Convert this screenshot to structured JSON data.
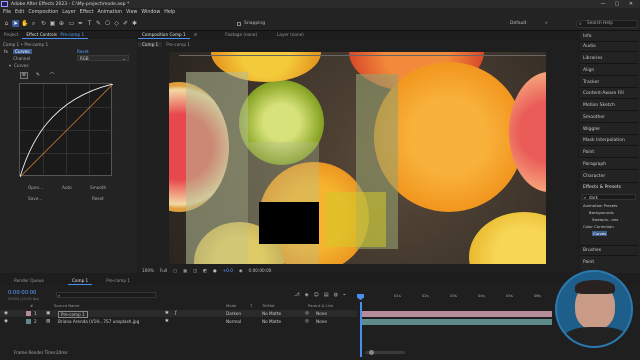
{
  "titlebar": {
    "title": "Adobe After Effects 2023 - C:\\My-project\\mode.aep *",
    "buttons": [
      "—",
      "▢",
      "✕"
    ]
  },
  "menu": [
    "File",
    "Edit",
    "Composition",
    "Layer",
    "Effect",
    "Animation",
    "View",
    "Window",
    "Help"
  ],
  "toolbar": {
    "snapping": "Snapping",
    "workspace_default": "Default",
    "workspace_menu": "»",
    "search_placeholder": "Search Help"
  },
  "project_panel": {
    "tab_project": "Project",
    "tab_effect_controls": "Effect Controls",
    "tab_layer": "Pre-comp 1",
    "path": "Comp 1 • Pre-comp 1"
  },
  "effect_controls": {
    "effect_name": "Curves",
    "fx_label": "fx",
    "reset_label": "Reset",
    "channel_label": "Channel",
    "channel_value": "RGB",
    "curves_label": "Curves",
    "buttons": [
      "Open...",
      "Auto",
      "Smooth",
      "Save...",
      "Reset"
    ]
  },
  "composition": {
    "tab_title": "Composition Comp 1",
    "menu_icon": "≡",
    "footage_tab": "Footage (none)",
    "layer_tab": "Layer (none)",
    "subtab_comp": "Comp 1",
    "subtab_precomp": "Pre-comp 1",
    "zoom": "100%",
    "resolution": "Full",
    "exposure": "+0.0",
    "timecode": "0:00:00:00"
  },
  "right_panel": {
    "items": [
      "Info",
      "Audio",
      "Libraries",
      "Align",
      "Tracker",
      "Content-Aware Fill",
      "Motion Sketch",
      "Smoother",
      "Wiggler",
      "Mask Interpolation",
      "Paint",
      "Paragraph",
      "Character"
    ],
    "effects_presets": {
      "title": "Effects & Presets",
      "search": "dark",
      "tree": [
        "Animation Presets",
        "Backgrounds",
        "Sweepin...nes",
        "Color Correction",
        "Curves"
      ]
    },
    "bottom_items": [
      "Brushes",
      "Paint"
    ]
  },
  "timeline": {
    "tab_render_queue": "Render Queue",
    "tab_comp": "Comp 1",
    "tab_precomp": "Pre-comp 1",
    "timecode": "0:00:00:00",
    "fps": "00000 (25.00 fps)",
    "search_placeholder": "",
    "columns": [
      "#",
      "Source Name",
      "Mode",
      "T",
      "TrkMat",
      "Parent & Link"
    ],
    "rows": [
      {
        "num": "1",
        "name": "Pre-comp 1",
        "mode": "Darken",
        "trkmat": "No Matte",
        "parent": "None"
      },
      {
        "num": "2",
        "name": "Briana Arenda (V1H...7S7 unsplash.jpg",
        "mode": "Normal",
        "trkmat": "No Matte",
        "parent": "None"
      }
    ],
    "ruler": [
      "0s",
      "01s",
      "02s",
      "03s",
      "04s",
      "05s",
      "06s"
    ],
    "frame_render": "Frame Render Time:",
    "frame_render_value": "24ms",
    "toggle_label": "Toggle Switches / Modes"
  },
  "colors": {
    "accent": "#4a8ff0",
    "layer_pink": "#b58c9a",
    "layer_teal": "#5e8a8a",
    "playhead": "#4a8ff0"
  }
}
